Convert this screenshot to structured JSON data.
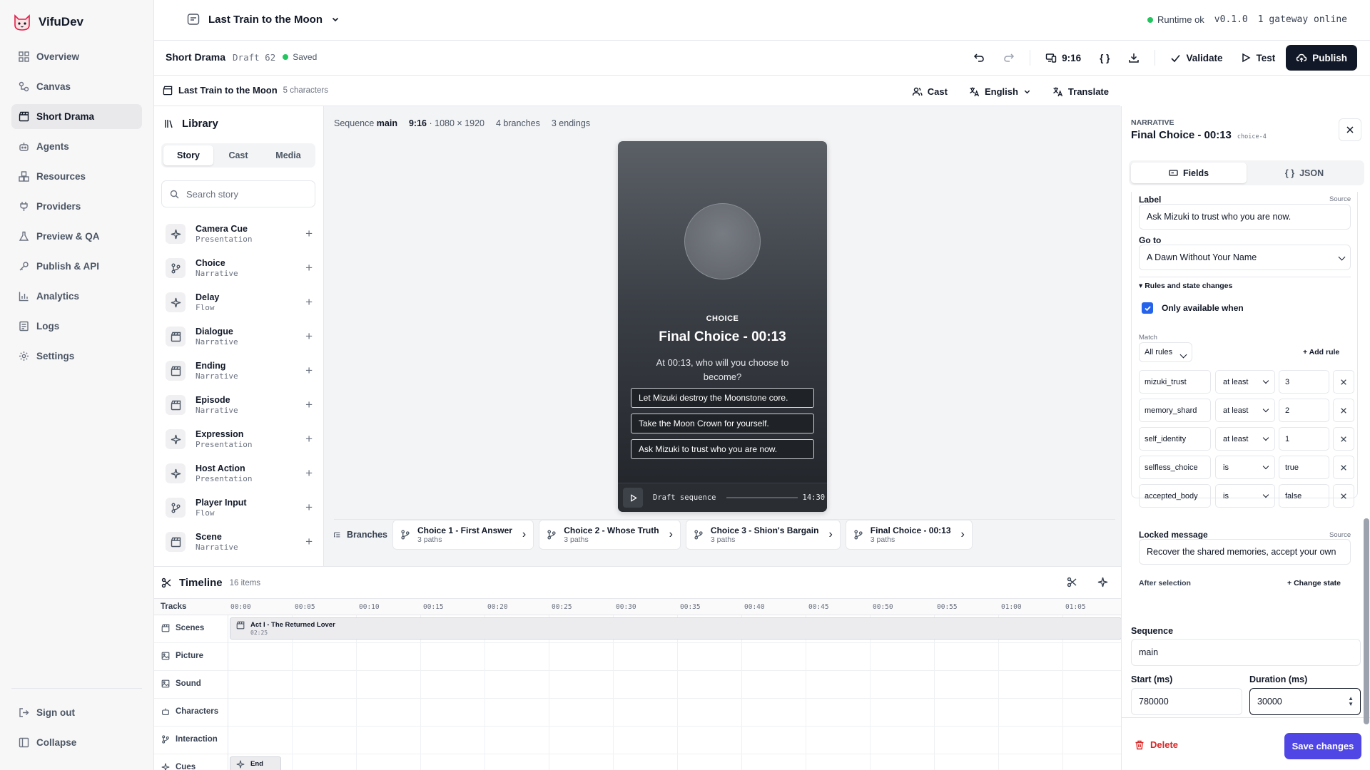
{
  "app": {
    "name": "VifuDev"
  },
  "sidebar": {
    "items": [
      {
        "label": "Overview",
        "icon": "grid-icon"
      },
      {
        "label": "Canvas",
        "icon": "workflow-icon"
      },
      {
        "label": "Short Drama",
        "icon": "clapperboard-icon",
        "active": true
      },
      {
        "label": "Agents",
        "icon": "bot-icon"
      },
      {
        "label": "Resources",
        "icon": "boxes-icon"
      },
      {
        "label": "Providers",
        "icon": "plug-icon"
      },
      {
        "label": "Preview & QA",
        "icon": "flask-icon"
      },
      {
        "label": "Publish & API",
        "icon": "key-icon"
      },
      {
        "label": "Analytics",
        "icon": "bar-chart-icon"
      },
      {
        "label": "Logs",
        "icon": "log-icon"
      },
      {
        "label": "Settings",
        "icon": "gear-icon"
      }
    ],
    "sign_out": "Sign out",
    "collapse": "Collapse"
  },
  "topbar": {
    "project": "Last Train to the Moon",
    "runtime": "Runtime ok",
    "version": "v0.1.0",
    "gateway": "1 gateway online"
  },
  "toolbar": {
    "title": "Short Drama",
    "draft": "Draft 62",
    "saved": "Saved",
    "ratio": "9:16",
    "validate": "Validate",
    "test": "Test",
    "publish": "Publish"
  },
  "context": {
    "title": "Last Train to the Moon",
    "characters": "5 characters",
    "cast": "Cast",
    "language": "English",
    "translate": "Translate"
  },
  "library": {
    "title": "Library",
    "tabs": [
      "Story",
      "Cast",
      "Media"
    ],
    "search_placeholder": "Search story",
    "items": [
      {
        "name": "Camera Cue",
        "category": "Presentation",
        "icon": "sparkles-icon"
      },
      {
        "name": "Choice",
        "category": "Narrative",
        "icon": "branch-icon"
      },
      {
        "name": "Delay",
        "category": "Flow",
        "icon": "sparkles-icon"
      },
      {
        "name": "Dialogue",
        "category": "Narrative",
        "icon": "clapperboard-icon"
      },
      {
        "name": "Ending",
        "category": "Narrative",
        "icon": "clapperboard-icon"
      },
      {
        "name": "Episode",
        "category": "Narrative",
        "icon": "clapperboard-icon"
      },
      {
        "name": "Expression",
        "category": "Presentation",
        "icon": "sparkles-icon"
      },
      {
        "name": "Host Action",
        "category": "Presentation",
        "icon": "sparkles-icon"
      },
      {
        "name": "Player Input",
        "category": "Flow",
        "icon": "branch-icon"
      },
      {
        "name": "Scene",
        "category": "Narrative",
        "icon": "clapperboard-icon"
      }
    ]
  },
  "canvas": {
    "sequence_label": "Sequence",
    "sequence": "main",
    "ratio": "9:16",
    "resolution": "· 1080 × 1920",
    "branches_count": "4 branches",
    "endings_count": "3 endings",
    "preview": {
      "kicker": "CHOICE",
      "title": "Final Choice - 00:13",
      "description": "At 00:13, who will you choose to become?",
      "options": [
        "Let Mizuki destroy the Moonstone core.",
        "Take the Moon Crown for yourself.",
        "Ask Mizuki to trust who you are now."
      ],
      "status": "Draft sequence",
      "time": "14:30"
    },
    "branches_label": "Branches",
    "branches": [
      {
        "title": "Choice 1 - First Answer",
        "paths": "3 paths"
      },
      {
        "title": "Choice 2 - Whose Truth",
        "paths": "3 paths"
      },
      {
        "title": "Choice 3 - Shion's Bargain",
        "paths": "3 paths"
      },
      {
        "title": "Final Choice - 00:13",
        "paths": "3 paths"
      }
    ]
  },
  "timeline": {
    "title": "Timeline",
    "count": "16 items",
    "tracks_label": "Tracks",
    "ticks": [
      "00:00",
      "00:05",
      "00:10",
      "00:15",
      "00:20",
      "00:25",
      "00:30",
      "00:35",
      "00:40",
      "00:45",
      "00:50",
      "00:55",
      "01:00",
      "01:05"
    ],
    "tracks": [
      {
        "name": "Scenes",
        "icon": "clapperboard-icon"
      },
      {
        "name": "Picture",
        "icon": "image-icon"
      },
      {
        "name": "Sound",
        "icon": "image-icon"
      },
      {
        "name": "Characters",
        "icon": "bot-icon"
      },
      {
        "name": "Interaction",
        "icon": "branch-icon"
      },
      {
        "name": "Cues",
        "icon": "sparkles-icon"
      }
    ],
    "scene_clip": {
      "title": "Act I - The Returned Lover",
      "duration": "02:25"
    },
    "cue_clip": {
      "title": "End"
    }
  },
  "panel": {
    "kicker": "NARRATIVE",
    "title": "Final Choice - 00:13",
    "id": "choice-4",
    "tabs": [
      "Fields",
      "JSON"
    ],
    "label_title": "Label",
    "source": "Source",
    "label_value": "Ask Mizuki to trust who you are now.",
    "goto_title": "Go to",
    "goto_value": "A Dawn Without Your Name",
    "rules_title": "Rules and state changes",
    "only_available": "Only available when",
    "match_label": "Match",
    "match_value": "All rules",
    "add_rule": "Add rule",
    "rules": [
      {
        "field": "mizuki_trust",
        "op": "at least",
        "value": "3"
      },
      {
        "field": "memory_shard",
        "op": "at least",
        "value": "2"
      },
      {
        "field": "self_identity",
        "op": "at least",
        "value": "1"
      },
      {
        "field": "selfless_choice",
        "op": "is",
        "value": "true"
      },
      {
        "field": "accepted_body",
        "op": "is",
        "value": "false"
      }
    ],
    "locked_title": "Locked message",
    "locked_value": "Recover the shared memories, accept your own",
    "after_selection": "After selection",
    "change_state": "Change state",
    "sequence_title": "Sequence",
    "sequence_value": "main",
    "start_title": "Start (ms)",
    "start_value": "780000",
    "duration_title": "Duration (ms)",
    "duration_value": "30000",
    "delete": "Delete",
    "save": "Save changes"
  },
  "colors": {
    "accent": "#4f46e5",
    "ok": "#22c55e",
    "danger": "#dc2626",
    "dark": "#111827"
  }
}
